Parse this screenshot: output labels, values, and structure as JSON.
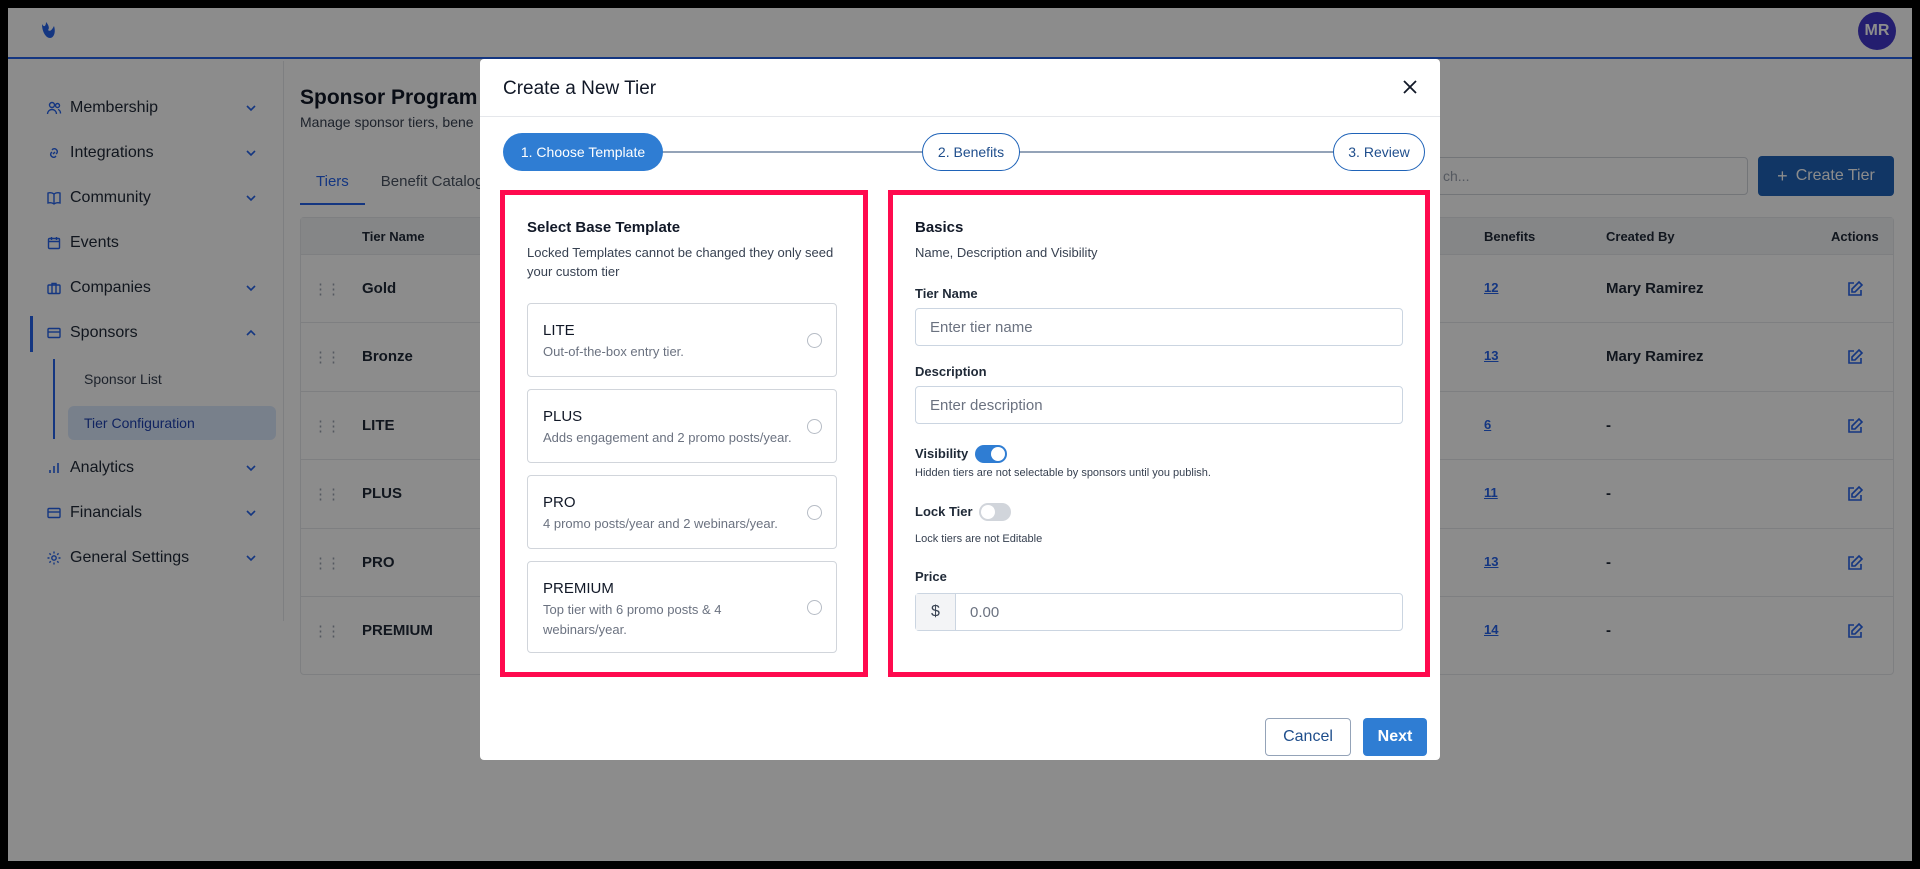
{
  "topbar": {
    "avatar_initials": "MR"
  },
  "sidebar": {
    "items": [
      {
        "label": "Membership",
        "icon": "users-icon"
      },
      {
        "label": "Integrations",
        "icon": "link-icon"
      },
      {
        "label": "Community",
        "icon": "book-icon"
      },
      {
        "label": "Events",
        "icon": "calendar-icon"
      },
      {
        "label": "Companies",
        "icon": "briefcase-icon"
      },
      {
        "label": "Sponsors",
        "icon": "card-icon"
      },
      {
        "label": "Analytics",
        "icon": "bar-chart-icon"
      },
      {
        "label": "Financials",
        "icon": "card-icon"
      },
      {
        "label": "General Settings",
        "icon": "gear-icon"
      }
    ],
    "sub_items": [
      {
        "label": "Sponsor List"
      },
      {
        "label": "Tier Configuration"
      }
    ]
  },
  "page": {
    "title": "Sponsor Program",
    "subtitle": "Manage sponsor tiers, bene",
    "tabs": [
      {
        "label": "Tiers"
      },
      {
        "label": "Benefit Catalog"
      }
    ],
    "search_placeholder": "ch...",
    "create_button": "Create Tier"
  },
  "table": {
    "headers": {
      "name": "Tier Name",
      "benefits": "Benefits",
      "created_by": "Created By",
      "actions": "Actions"
    },
    "rows": [
      {
        "name": "Gold",
        "benefits": "12",
        "created_by": "Mary Ramirez"
      },
      {
        "name": "Bronze",
        "benefits": "13",
        "created_by": "Mary Ramirez"
      },
      {
        "name": "LITE",
        "benefits": "6",
        "created_by": "-"
      },
      {
        "name": "PLUS",
        "benefits": "11",
        "created_by": "-"
      },
      {
        "name": "PRO",
        "benefits": "13",
        "created_by": "-"
      },
      {
        "name": "PREMIUM",
        "benefits": "14",
        "created_by": "-"
      }
    ]
  },
  "modal": {
    "title": "Create a New Tier",
    "steps": [
      {
        "label": "1. Choose Template"
      },
      {
        "label": "2. Benefits"
      },
      {
        "label": "3. Review"
      }
    ],
    "template_section": {
      "title": "Select Base Template",
      "description": "Locked Templates cannot be changed they only seed your custom tier",
      "templates": [
        {
          "name": "LITE",
          "description": "Out-of-the-box entry tier."
        },
        {
          "name": "PLUS",
          "description": "Adds engagement and 2 promo posts/year."
        },
        {
          "name": "PRO",
          "description": "4 promo posts/year and 2 webinars/year."
        },
        {
          "name": "PREMIUM",
          "description": "Top tier with 6 promo posts & 4 webinars/year."
        }
      ]
    },
    "basics": {
      "title": "Basics",
      "description": "Name, Description and Visibility",
      "tier_name_label": "Tier Name",
      "tier_name_placeholder": "Enter tier name",
      "description_label": "Description",
      "description_placeholder": "Enter description",
      "visibility_label": "Visibility",
      "visibility_hint": "Hidden tiers are not selectable by sponsors until you publish.",
      "lock_label": "Lock Tier",
      "lock_hint": "Lock tiers are not Editable",
      "price_label": "Price",
      "price_prefix": "$",
      "price_placeholder": "0.00"
    },
    "cancel_button": "Cancel",
    "next_button": "Next"
  }
}
